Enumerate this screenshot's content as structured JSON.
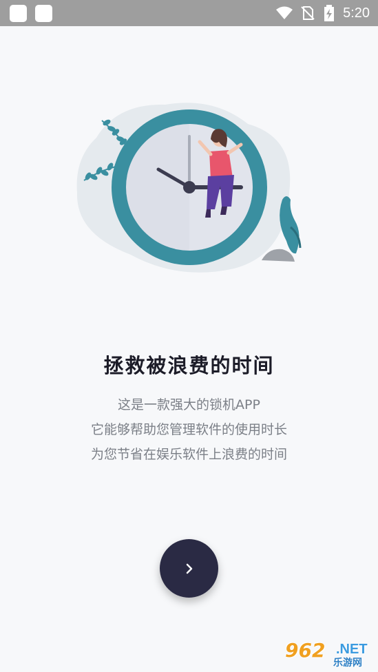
{
  "status_bar": {
    "time": "5:20",
    "icons": [
      "app-notification-icon",
      "app-notification-icon",
      "wifi-icon",
      "no-sim-icon",
      "battery-charging-icon"
    ]
  },
  "onboarding": {
    "title": "拯救被浪费的时间",
    "description": [
      "这是一款强大的锁机APP",
      "它能够帮助您管理软件的使用时长",
      "为您节省在娱乐软件上浪费的时间"
    ],
    "next_icon": "chevron-right-icon"
  },
  "watermark": {
    "number": "962",
    "suffix": ".NET",
    "subtitle": "乐游网"
  },
  "colors": {
    "background": "#f7f8fa",
    "status_bar": "#9e9e9e",
    "clock_ring": "#3a8fa0",
    "button": "#2a2a44",
    "title": "#1c1c28",
    "description": "#7b7f87"
  }
}
